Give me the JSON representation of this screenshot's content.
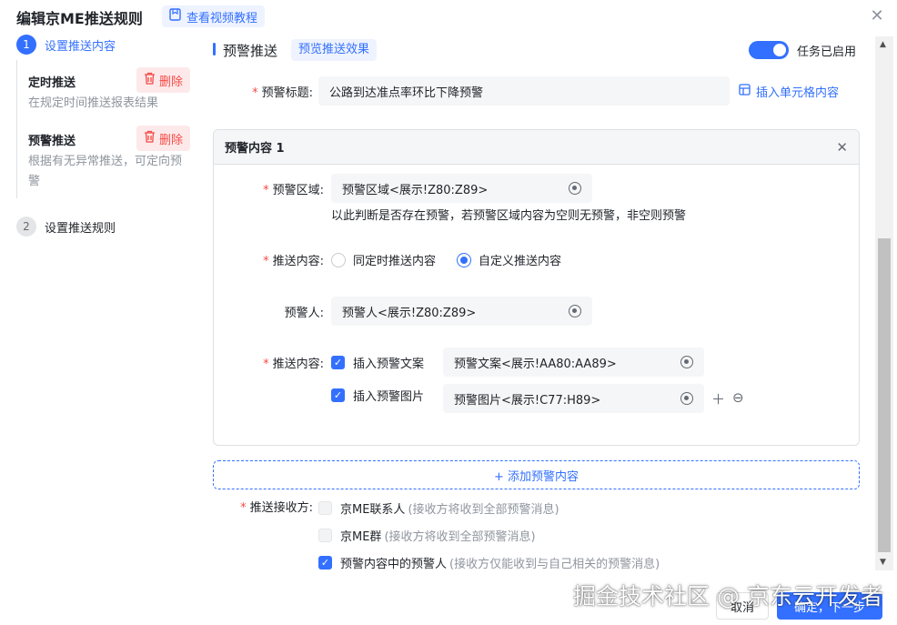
{
  "header": {
    "title": "编辑京ME推送规则",
    "video_link": "查看视频教程"
  },
  "steps": [
    {
      "num": "1",
      "label": "设置推送内容"
    },
    {
      "num": "2",
      "label": "设置推送规则"
    }
  ],
  "sidebar_items": [
    {
      "title": "定时推送",
      "desc": "在规定时间推送报表结果",
      "delete_label": "删除"
    },
    {
      "title": "预警推送",
      "desc": "根据有无异常推送，可定向预警",
      "delete_label": "删除"
    }
  ],
  "section": {
    "title": "预警推送",
    "preview_label": "预览推送效果",
    "toggle_label": "任务已启用"
  },
  "alert_title": {
    "label": "预警标题:",
    "value": "公路到达准点率环比下降预警",
    "insert_label": "插入单元格内容"
  },
  "card": {
    "title": "预警内容 1",
    "area_label": "预警区域:",
    "area_value": "预警区域<展示!Z80:Z89>",
    "area_hint": "以此判断是否存在预警，若预警区域内容为空则无预警，非空则预警",
    "push_label": "推送内容:",
    "radio_options": [
      "同定时推送内容",
      "自定义推送内容"
    ],
    "person_label": "预警人:",
    "person_value": "预警人<展示!Z80:Z89>",
    "push_label2": "推送内容:",
    "check_text": "插入预警文案",
    "text_value": "预警文案<展示!AA80:AA89>",
    "check_image": "插入预警图片",
    "image_value": "预警图片<展示!C77:H89>"
  },
  "add_button": "+ 添加预警内容",
  "receivers": {
    "label": "推送接收方:",
    "options": [
      {
        "name": "京ME联系人",
        "note": "(接收方将收到全部预警消息)",
        "checked": false
      },
      {
        "name": "京ME群",
        "note": "(接收方将收到全部预警消息)",
        "checked": false
      },
      {
        "name": "预警内容中的预警人",
        "note": "(接收方仅能收到与自己相关的预警消息)",
        "checked": true
      }
    ]
  },
  "footer": {
    "cancel": "取消",
    "next": "确定，下一步"
  },
  "watermark": "掘金技术社区 @ 京东云开发者",
  "colors": {
    "primary": "#3370ff",
    "danger": "#f54a45"
  }
}
